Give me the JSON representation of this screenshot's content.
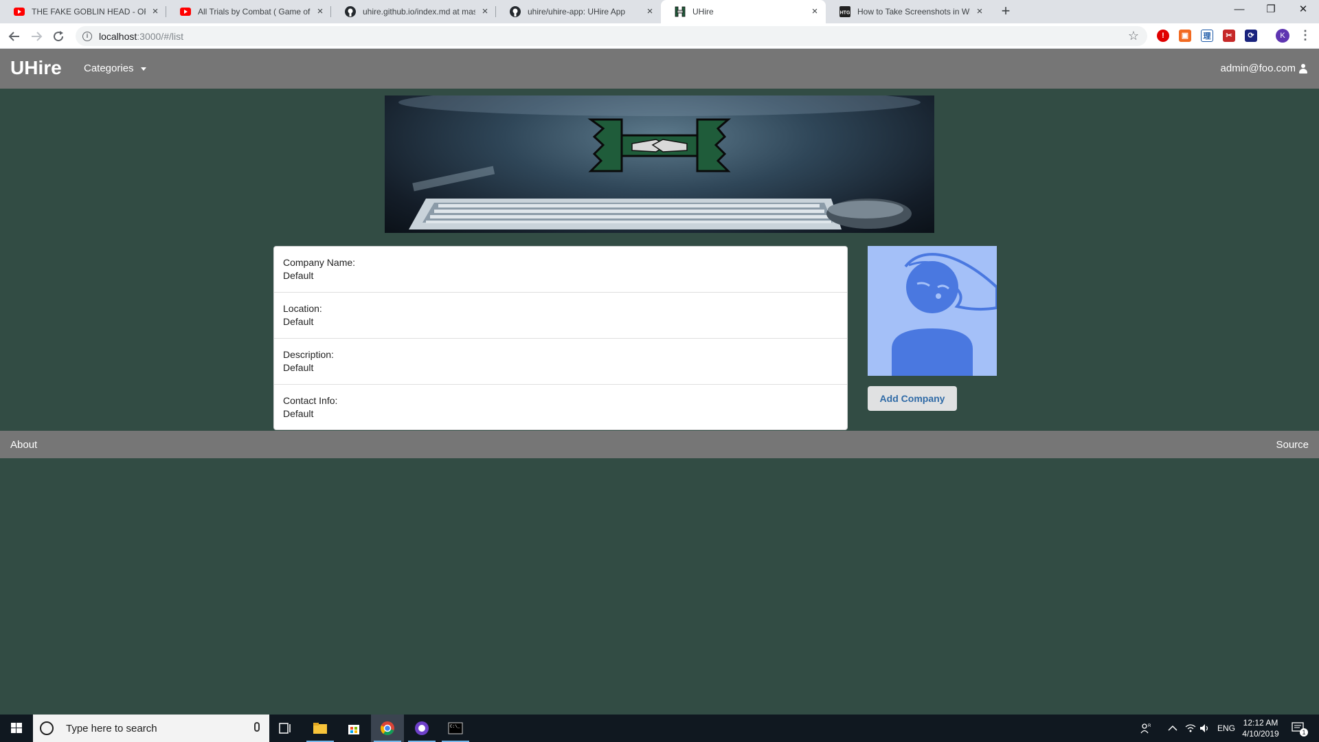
{
  "browser": {
    "tabs": [
      {
        "title": "THE FAKE GOBLIN HEAD - OFFLINE",
        "icon": "youtube-icon"
      },
      {
        "title": "All Trials by Combat ( Game of Thrones )",
        "icon": "youtube-icon"
      },
      {
        "title": "uhire.github.io/index.md at master",
        "icon": "github-icon"
      },
      {
        "title": "uhire/uhire-app: UHire App",
        "icon": "github-icon"
      },
      {
        "title": "UHire",
        "icon": "uhire-icon",
        "active": true
      },
      {
        "title": "How to Take Screenshots in Windows",
        "icon": "htg-icon"
      }
    ],
    "url_host": "localhost",
    "url_path": ":3000/#/list",
    "profile_initial": "K"
  },
  "app": {
    "brand": "UHire",
    "nav_categories": "Categories",
    "user_email": "admin@foo.com",
    "company": {
      "fields": [
        {
          "label": "Company Name:",
          "value": "Default"
        },
        {
          "label": "Location:",
          "value": "Default"
        },
        {
          "label": "Description:",
          "value": "Default"
        },
        {
          "label": "Contact Info:",
          "value": "Default"
        }
      ]
    },
    "add_company_label": "Add Company",
    "footer": {
      "about": "About",
      "source": "Source"
    }
  },
  "taskbar": {
    "search_placeholder": "Type here to search",
    "language": "ENG",
    "time": "12:12 AM",
    "date": "4/10/2019",
    "notification_count": "1"
  },
  "colors": {
    "page_bg": "#324c44",
    "navbar_bg": "#767676",
    "avatar_bg": "#a4c0f8",
    "avatar_fg": "#4a78e0",
    "button_text": "#2f6aa6"
  }
}
